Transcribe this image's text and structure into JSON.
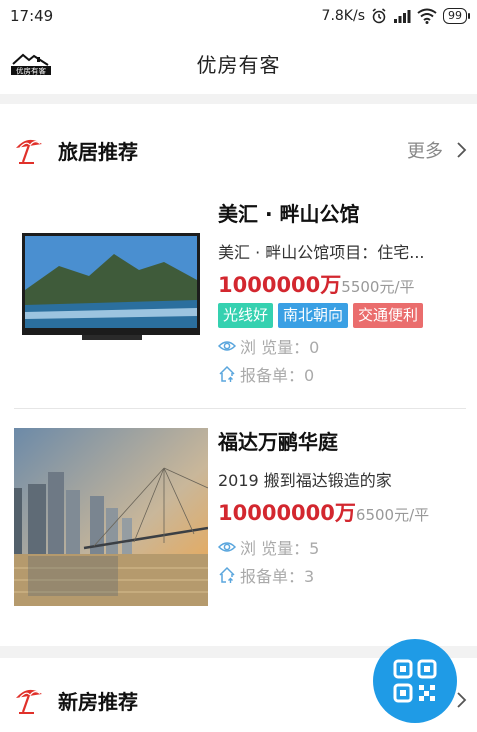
{
  "status_bar": {
    "time": "17:49",
    "network_speed": "7.8K/s",
    "battery": "99"
  },
  "header": {
    "logo_text": "优房有客",
    "title": "优房有客"
  },
  "sections": [
    {
      "title": "旅居推荐",
      "more_label": "更多",
      "items": [
        {
          "name": "美汇 · 畔山公馆",
          "desc": "美汇 · 畔山公馆项目：住宅...",
          "price": "1000000万",
          "unit_price": "5500元/平",
          "tags": [
            "光线好",
            "南北朝向",
            "交通便利"
          ],
          "views_label": "浏 览量：0",
          "reports_label": "报备单：0"
        },
        {
          "name": "福达万鹂华庭",
          "desc": "2019 搬到福达锻造的家",
          "price": "10000000万",
          "unit_price": "6500元/平",
          "tags": [],
          "views_label": "浏 览量：5",
          "reports_label": "报备单：3"
        }
      ]
    },
    {
      "title": "新房推荐"
    }
  ],
  "colors": {
    "price": "#d3272f",
    "tag_1": "#35d1b0",
    "tag_2": "#3aa0e4",
    "tag_3": "#ea6d6d",
    "fab": "#1f9be6",
    "section_icon": "#e0302a"
  },
  "icons": {
    "section": "umbrella-icon",
    "views": "eye-icon",
    "reports": "house-upload-icon",
    "fab": "qr-scan-icon"
  }
}
